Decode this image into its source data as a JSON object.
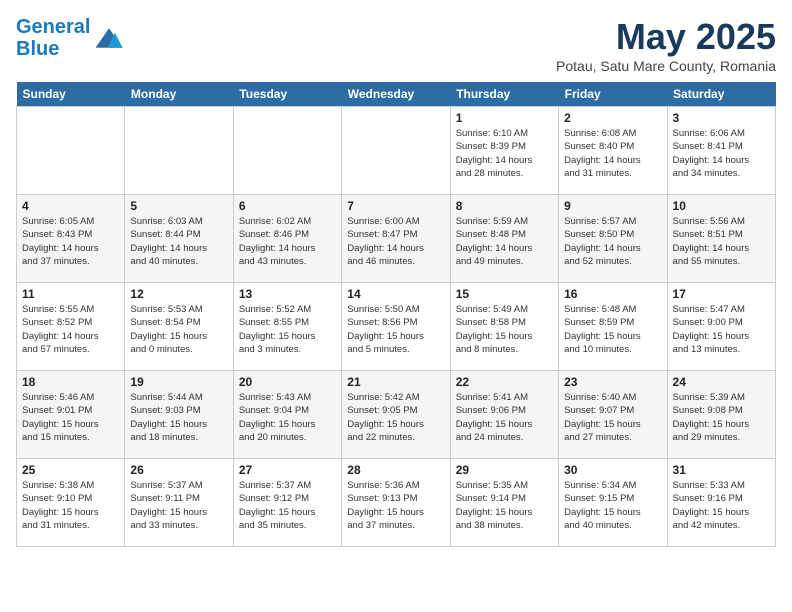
{
  "logo": {
    "line1": "General",
    "line2": "Blue"
  },
  "title": "May 2025",
  "subtitle": "Potau, Satu Mare County, Romania",
  "weekdays": [
    "Sunday",
    "Monday",
    "Tuesday",
    "Wednesday",
    "Thursday",
    "Friday",
    "Saturday"
  ],
  "weeks": [
    [
      {
        "day": "",
        "info": ""
      },
      {
        "day": "",
        "info": ""
      },
      {
        "day": "",
        "info": ""
      },
      {
        "day": "",
        "info": ""
      },
      {
        "day": "1",
        "info": "Sunrise: 6:10 AM\nSunset: 8:39 PM\nDaylight: 14 hours\nand 28 minutes."
      },
      {
        "day": "2",
        "info": "Sunrise: 6:08 AM\nSunset: 8:40 PM\nDaylight: 14 hours\nand 31 minutes."
      },
      {
        "day": "3",
        "info": "Sunrise: 6:06 AM\nSunset: 8:41 PM\nDaylight: 14 hours\nand 34 minutes."
      }
    ],
    [
      {
        "day": "4",
        "info": "Sunrise: 6:05 AM\nSunset: 8:43 PM\nDaylight: 14 hours\nand 37 minutes."
      },
      {
        "day": "5",
        "info": "Sunrise: 6:03 AM\nSunset: 8:44 PM\nDaylight: 14 hours\nand 40 minutes."
      },
      {
        "day": "6",
        "info": "Sunrise: 6:02 AM\nSunset: 8:46 PM\nDaylight: 14 hours\nand 43 minutes."
      },
      {
        "day": "7",
        "info": "Sunrise: 6:00 AM\nSunset: 8:47 PM\nDaylight: 14 hours\nand 46 minutes."
      },
      {
        "day": "8",
        "info": "Sunrise: 5:59 AM\nSunset: 8:48 PM\nDaylight: 14 hours\nand 49 minutes."
      },
      {
        "day": "9",
        "info": "Sunrise: 5:57 AM\nSunset: 8:50 PM\nDaylight: 14 hours\nand 52 minutes."
      },
      {
        "day": "10",
        "info": "Sunrise: 5:56 AM\nSunset: 8:51 PM\nDaylight: 14 hours\nand 55 minutes."
      }
    ],
    [
      {
        "day": "11",
        "info": "Sunrise: 5:55 AM\nSunset: 8:52 PM\nDaylight: 14 hours\nand 57 minutes."
      },
      {
        "day": "12",
        "info": "Sunrise: 5:53 AM\nSunset: 8:54 PM\nDaylight: 15 hours\nand 0 minutes."
      },
      {
        "day": "13",
        "info": "Sunrise: 5:52 AM\nSunset: 8:55 PM\nDaylight: 15 hours\nand 3 minutes."
      },
      {
        "day": "14",
        "info": "Sunrise: 5:50 AM\nSunset: 8:56 PM\nDaylight: 15 hours\nand 5 minutes."
      },
      {
        "day": "15",
        "info": "Sunrise: 5:49 AM\nSunset: 8:58 PM\nDaylight: 15 hours\nand 8 minutes."
      },
      {
        "day": "16",
        "info": "Sunrise: 5:48 AM\nSunset: 8:59 PM\nDaylight: 15 hours\nand 10 minutes."
      },
      {
        "day": "17",
        "info": "Sunrise: 5:47 AM\nSunset: 9:00 PM\nDaylight: 15 hours\nand 13 minutes."
      }
    ],
    [
      {
        "day": "18",
        "info": "Sunrise: 5:46 AM\nSunset: 9:01 PM\nDaylight: 15 hours\nand 15 minutes."
      },
      {
        "day": "19",
        "info": "Sunrise: 5:44 AM\nSunset: 9:03 PM\nDaylight: 15 hours\nand 18 minutes."
      },
      {
        "day": "20",
        "info": "Sunrise: 5:43 AM\nSunset: 9:04 PM\nDaylight: 15 hours\nand 20 minutes."
      },
      {
        "day": "21",
        "info": "Sunrise: 5:42 AM\nSunset: 9:05 PM\nDaylight: 15 hours\nand 22 minutes."
      },
      {
        "day": "22",
        "info": "Sunrise: 5:41 AM\nSunset: 9:06 PM\nDaylight: 15 hours\nand 24 minutes."
      },
      {
        "day": "23",
        "info": "Sunrise: 5:40 AM\nSunset: 9:07 PM\nDaylight: 15 hours\nand 27 minutes."
      },
      {
        "day": "24",
        "info": "Sunrise: 5:39 AM\nSunset: 9:08 PM\nDaylight: 15 hours\nand 29 minutes."
      }
    ],
    [
      {
        "day": "25",
        "info": "Sunrise: 5:38 AM\nSunset: 9:10 PM\nDaylight: 15 hours\nand 31 minutes."
      },
      {
        "day": "26",
        "info": "Sunrise: 5:37 AM\nSunset: 9:11 PM\nDaylight: 15 hours\nand 33 minutes."
      },
      {
        "day": "27",
        "info": "Sunrise: 5:37 AM\nSunset: 9:12 PM\nDaylight: 15 hours\nand 35 minutes."
      },
      {
        "day": "28",
        "info": "Sunrise: 5:36 AM\nSunset: 9:13 PM\nDaylight: 15 hours\nand 37 minutes."
      },
      {
        "day": "29",
        "info": "Sunrise: 5:35 AM\nSunset: 9:14 PM\nDaylight: 15 hours\nand 38 minutes."
      },
      {
        "day": "30",
        "info": "Sunrise: 5:34 AM\nSunset: 9:15 PM\nDaylight: 15 hours\nand 40 minutes."
      },
      {
        "day": "31",
        "info": "Sunrise: 5:33 AM\nSunset: 9:16 PM\nDaylight: 15 hours\nand 42 minutes."
      }
    ]
  ]
}
